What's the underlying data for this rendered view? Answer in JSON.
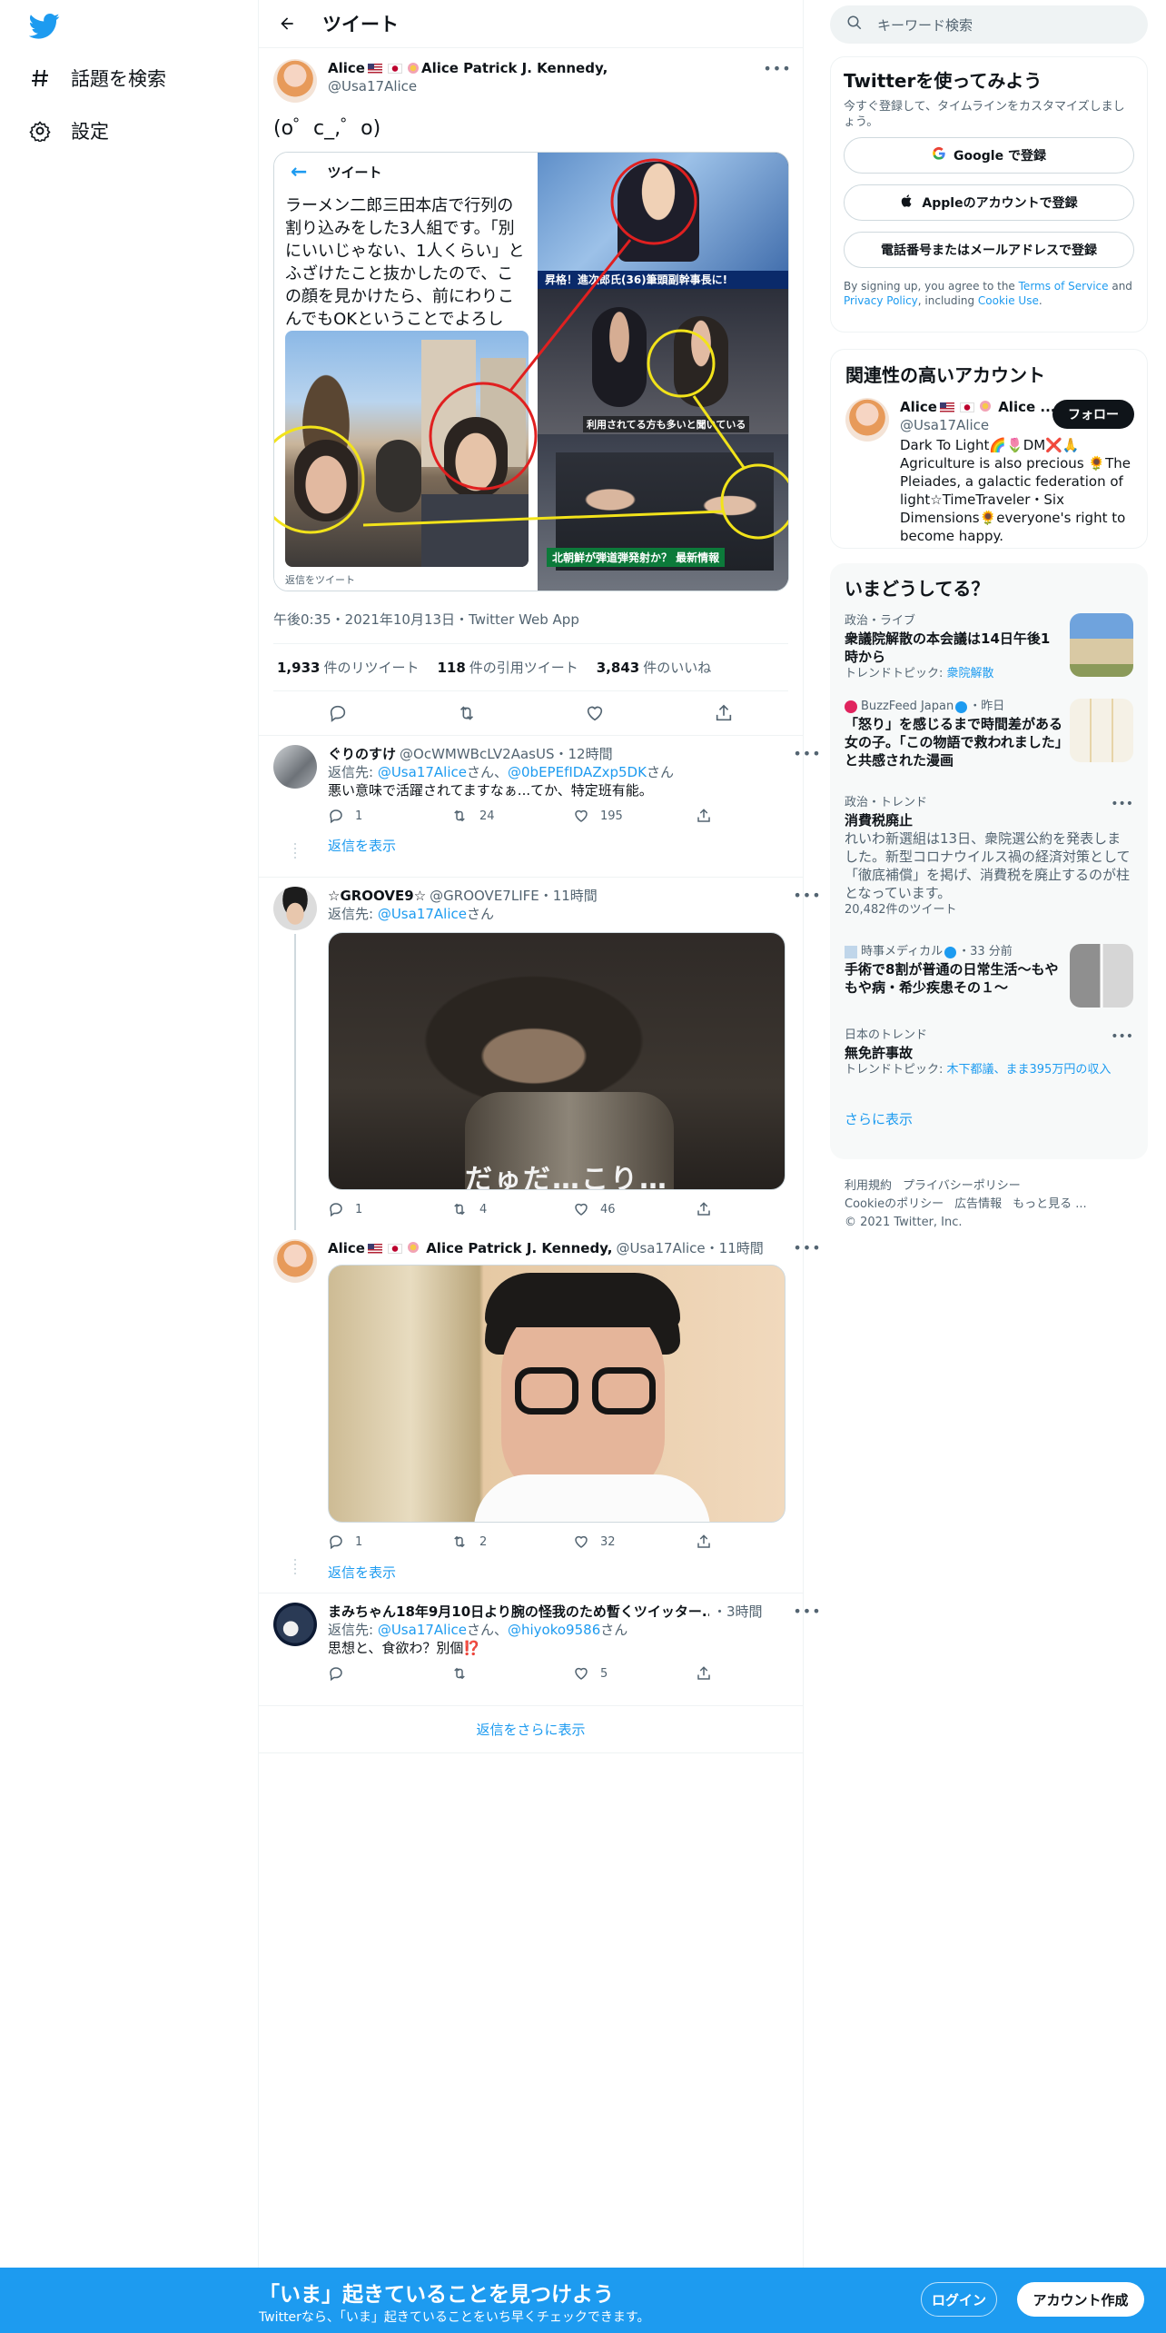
{
  "nav": {
    "explore_label": "話題を検索",
    "settings_label": "設定"
  },
  "header": {
    "title": "ツイート"
  },
  "main_tweet": {
    "author_name": "Alice Alice Patrick J. Kennedy,",
    "author_handle": "@Usa17Alice",
    "text": "(o゜c_,゜o)",
    "embedded": {
      "header": "ツイート",
      "text": "ラーメン二郎三田本店で行列の割り込みをした3人組です。「別にいいじゃない、1人くらい」とふざけたこと抜かしたので、この顔を見かけたら、前にわりこんでもOKということでよろしく。",
      "reply_label": "返信をツイート",
      "banner": "昇格！進次郎氏(36)筆頭副幹事長に!",
      "caption_mid": "利用されてる方も多いと聞いている",
      "caption_low": "北朝鮮が弾道弾発射か？ 最新情報"
    },
    "meta": "午後0:35・2021年10月13日・Twitter Web App",
    "stats": [
      {
        "count": "1,933",
        "label": "件のリツイート"
      },
      {
        "count": "118",
        "label": "件の引用ツイート"
      },
      {
        "count": "3,843",
        "label": "件のいいね"
      }
    ]
  },
  "replies": [
    {
      "name": "ぐりのすけ",
      "handle": "@OcWMWBcLV2AasUS・12時間",
      "replyto_prefix": "返信先: ",
      "replyto_1": "@Usa17Alice",
      "replyto_mid": "さん、",
      "replyto_2": "@0bEPEfIDAZxp5DK",
      "replyto_suffix": "さん",
      "text": "悪い意味で活躍されてますなぁ...てか、特定班有能。",
      "replies": "1",
      "retweets": "24",
      "likes": "195",
      "show_replies": "返信を表示"
    },
    {
      "name": "☆GROOVE9☆",
      "handle": "@GROOVE7LIFE・11時間",
      "replyto_prefix": "返信先: ",
      "replyto_1": "@Usa17Alice",
      "replyto_suffix": "さん",
      "media_caption": "だゅだ…こり…",
      "replies": "1",
      "retweets": "4",
      "likes": "46"
    },
    {
      "name": "Alice Alice Patrick J. Kennedy,",
      "handle": "@Usa17Alice・11時間",
      "replies": "1",
      "retweets": "2",
      "likes": "32",
      "show_replies": "返信を表示"
    },
    {
      "name": "まみちゃん18年9月10日より腕の怪我のため暫くツイッター...",
      "handle": "・3時間",
      "replyto_prefix": "返信先: ",
      "replyto_1": "@Usa17Alice",
      "replyto_mid": "さん、",
      "replyto_2": "@hiyoko9586",
      "replyto_suffix": "さん",
      "text": "思想と、食欲わ？別個⁉️",
      "likes": "5"
    }
  ],
  "more_replies": "返信をさらに表示",
  "search": {
    "placeholder": "キーワード検索"
  },
  "signup": {
    "title": "Twitterを使ってみよう",
    "subtitle": "今すぐ登録して、タイムラインをカスタマイズしましょう。",
    "google": "Google で登録",
    "apple": "Appleのアカウントで登録",
    "email": "電話番号またはメールアドレスで登録",
    "terms_1": "By signing up, you agree to the ",
    "terms_tos": "Terms of Service",
    "terms_2": " and ",
    "terms_privacy": "Privacy Policy",
    "terms_3": ", including ",
    "terms_cookie": "Cookie Use",
    "terms_4": "."
  },
  "related": {
    "title": "関連性の高いアカウント",
    "name": "Alice Alice ...",
    "handle": "@Usa17Alice",
    "follow": "フォロー",
    "bio": "Dark To Light🌈🌷DM❌🙏 Agriculture is also precious 🌻The Pleiades, a galactic federation of light☆TimeTraveler・Six Dimensions🌻everyone's right to become happy."
  },
  "trends": {
    "title": "いまどうしてる？",
    "items": [
      {
        "context": "政治・ライブ",
        "title": "衆議院解散の本会議は14日午後1時から",
        "sub_prefix": "トレンドトピック: ",
        "sub_link": "衆院解散"
      },
      {
        "context": "BuzzFeed Japan",
        "context_suffix": "・昨日",
        "title": "「怒り」を感じるまで時間差がある女の子。「この物語で救われました」と共感された漫画"
      },
      {
        "context": "政治・トレンド",
        "title": "消費税廃止",
        "desc": "れいわ新選組は13日、衆院選公約を発表しました。新型コロナウイルス禍の経済対策として「徹底補償」を掲げ、消費税を廃止するのが柱となっています。",
        "count": "20,482件のツイート"
      },
      {
        "context": "時事メディカル",
        "context_suffix": "・33 分前",
        "title": "手術で8割が普通の日常生活～もやもや病・希少疾患その１～"
      },
      {
        "context": "日本のトレンド",
        "title": "無免許事故",
        "sub_prefix": "トレンドトピック: ",
        "sub_link": "木下都議、まま395万円の収入"
      }
    ],
    "more": "さらに表示"
  },
  "footer": {
    "links": [
      "利用規約",
      "プライバシーポリシー",
      "Cookieのポリシー",
      "広告情報",
      "もっと見る ..."
    ],
    "copyright": "© 2021 Twitter, Inc."
  },
  "bottombar": {
    "title": "「いま」起きていることを見つけよう",
    "subtitle": "Twitterなら、「いま」起きていることをいち早くチェックできます。",
    "login": "ログイン",
    "signup": "アカウント作成"
  },
  "colors": {
    "accent": "#1d9bf0",
    "text": "#0f1419",
    "muted": "#536471"
  }
}
